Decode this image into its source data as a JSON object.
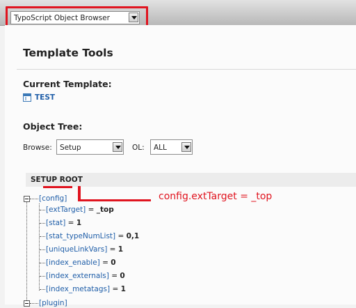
{
  "header": {
    "module_menu": {
      "selected": "TypoScript Object Browser"
    }
  },
  "main": {
    "title": "Template Tools",
    "current_template": {
      "label": "Current Template:",
      "name": "TEST",
      "icon": "template-icon"
    },
    "object_tree": {
      "label": "Object Tree:",
      "browse_label": "Browse:",
      "browse_value": "Setup",
      "ol_label": "OL:",
      "ol_value": "ALL"
    },
    "tree": {
      "root_label": "SETUP ROOT",
      "config": {
        "label": "[config]",
        "children": [
          {
            "key": "[extTarget]",
            "op": " = ",
            "value": "_top"
          },
          {
            "key": "[stat]",
            "op": " = ",
            "value": "1"
          },
          {
            "key": "[stat_typeNumList]",
            "op": " = ",
            "value": "0,1"
          },
          {
            "key": "[uniqueLinkVars]",
            "op": " = ",
            "value": "1"
          },
          {
            "key": "[index_enable]",
            "op": " = ",
            "value": "0"
          },
          {
            "key": "[index_externals]",
            "op": " = ",
            "value": "0"
          },
          {
            "key": "[index_metatags]",
            "op": " = ",
            "value": "1"
          }
        ]
      },
      "plugin_label": "[plugin]"
    },
    "annotation": "config.extTarget = _top"
  },
  "colors": {
    "highlight_red": "#e0141f",
    "link_blue": "#1f5ea8"
  }
}
